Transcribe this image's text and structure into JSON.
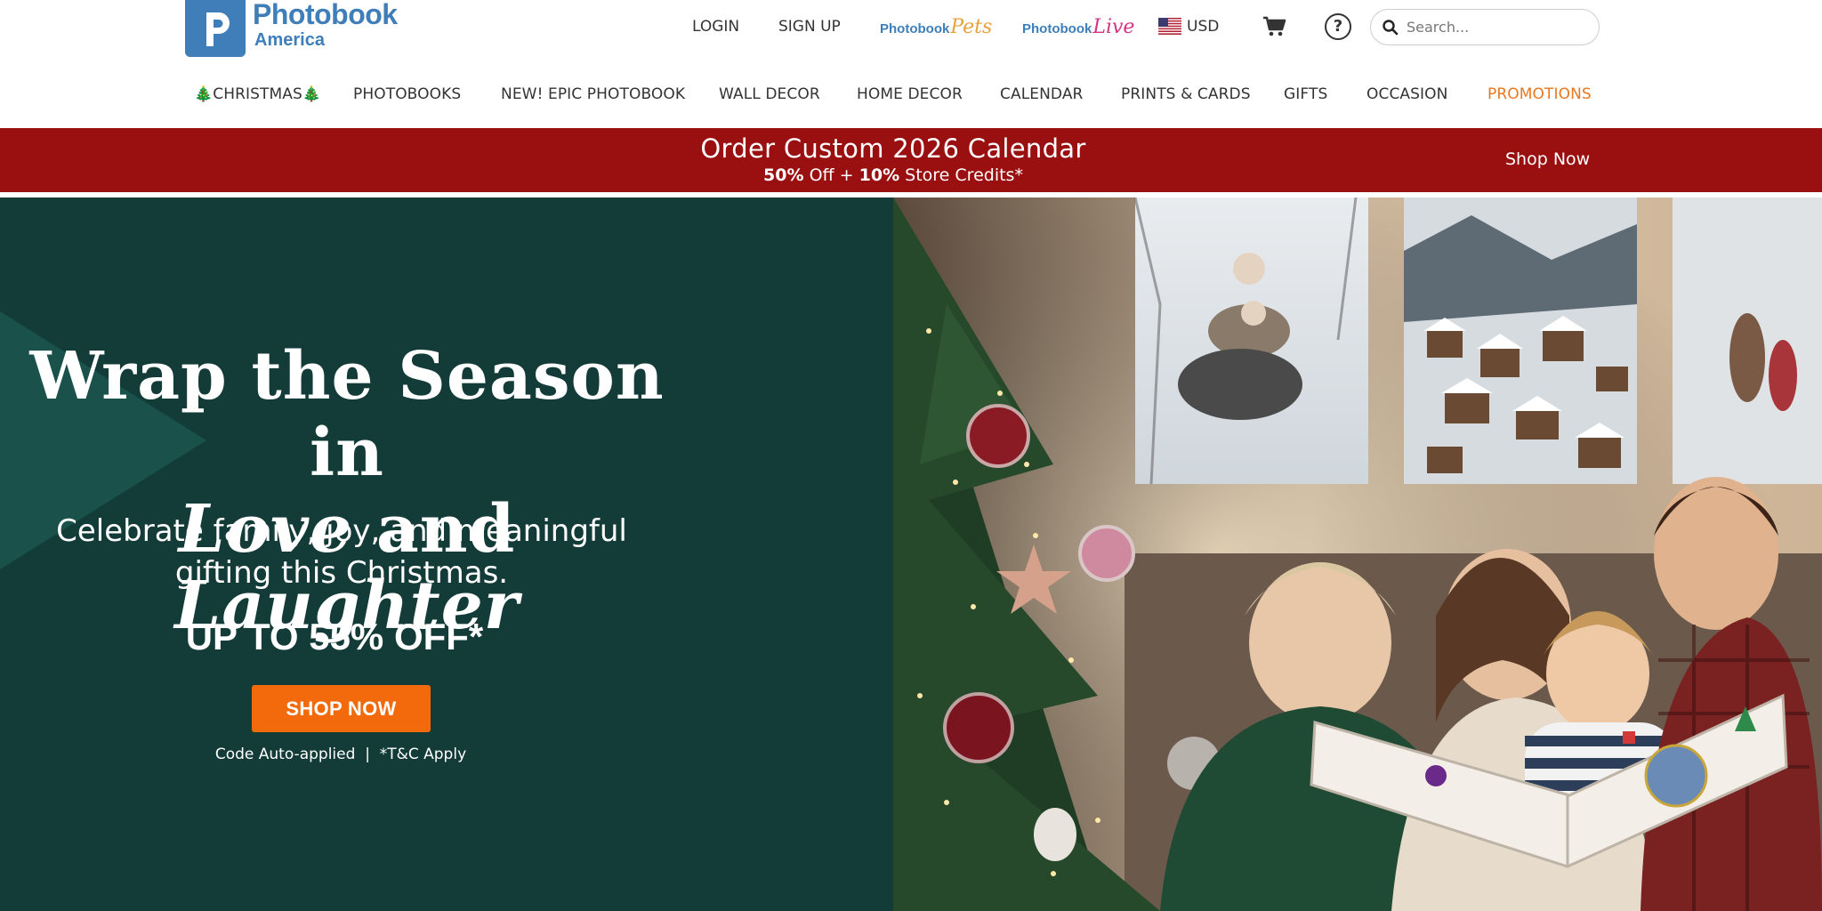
{
  "brand": {
    "name_line1": "Photobook",
    "name_line2": "America",
    "logo_letter": "p",
    "color": "#3f7eb8"
  },
  "header": {
    "login": "LOGIN",
    "signup": "SIGN UP",
    "sub_brands": [
      {
        "prefix": "Photobook",
        "script": "Pets",
        "script_color": "#e6a23c"
      },
      {
        "prefix": "Photobook",
        "script": "Live",
        "script_color": "#d63384"
      }
    ],
    "currency": "USD",
    "cart_icon": "cart-icon",
    "help_icon": "help-icon",
    "help_glyph": "?",
    "search_placeholder": "Search..."
  },
  "nav": {
    "items": [
      {
        "label": "🎄CHRISTMAS🎄"
      },
      {
        "label": "PHOTOBOOKS"
      },
      {
        "label": "NEW! EPIC PHOTOBOOK"
      },
      {
        "label": "WALL DECOR"
      },
      {
        "label": "HOME DECOR"
      },
      {
        "label": "CALENDAR"
      },
      {
        "label": "PRINTS & CARDS"
      },
      {
        "label": "GIFTS"
      },
      {
        "label": "OCCASION"
      },
      {
        "label": "PROMOTIONS"
      }
    ],
    "promo_color": "#e87722"
  },
  "banner": {
    "title": "Order Custom 2026 Calendar",
    "sub_pct1": "50%",
    "sub_mid": " Off + ",
    "sub_pct2": "10%",
    "sub_end": " Store Credits*",
    "cta": "Shop Now",
    "bg_color": "#9a1010"
  },
  "hero": {
    "headline_line1": "Wrap the Season in",
    "headline_love": "Love",
    "headline_and": " and ",
    "headline_laughter": "Laughter",
    "subhead_line1": "Celebrate family, joy, and meaningful",
    "subhead_line2": "gifting this Christmas.",
    "offer": "UP TO 55% OFF*",
    "cta": "SHOP NOW",
    "fineprint": "Code Auto-applied  |  *T&C Apply",
    "bg_color": "#133b38",
    "cta_color": "#f26a0c",
    "image_alt": "Family reading a Christmas photobook by a decorated tree with canvas wall prints"
  }
}
